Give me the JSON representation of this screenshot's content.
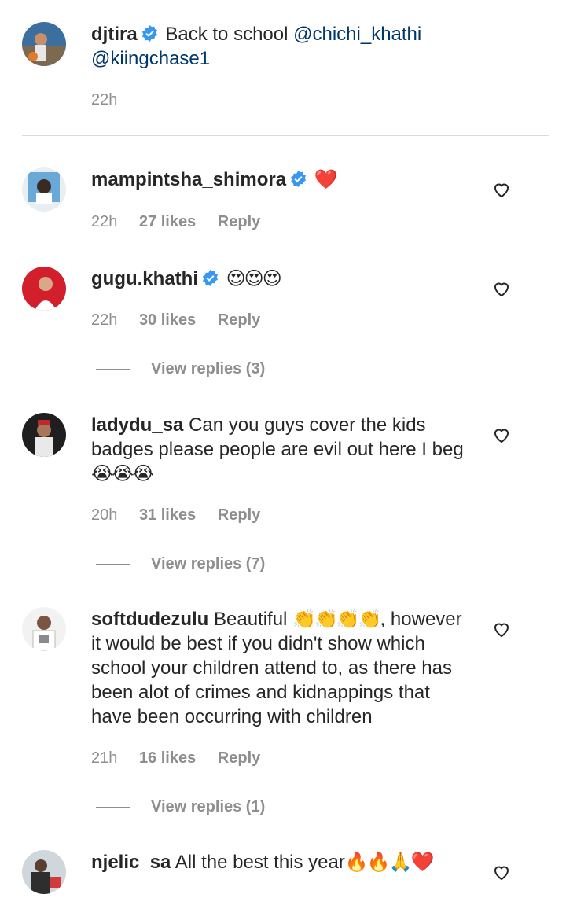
{
  "caption": {
    "username": "djtira",
    "text": "Back to school",
    "mentions": [
      "@chichi_khathi",
      "@kiingchase1"
    ],
    "time": "22h"
  },
  "comments": [
    {
      "username": "mampintsha_shimora",
      "verified": true,
      "text": "",
      "emoji": "❤️",
      "time": "22h",
      "likes": "27 likes",
      "reply": "Reply",
      "avatar_color": "#6aa8d8"
    },
    {
      "username": "gugu.khathi",
      "verified": true,
      "text": "",
      "emoji": "😍😍😍",
      "time": "22h",
      "likes": "30 likes",
      "reply": "Reply",
      "view_replies": "View replies (3)",
      "avatar_color": "#d21f2b"
    },
    {
      "username": "ladydu_sa",
      "verified": false,
      "text": "Can you guys cover the kids badges please people are evil out here I beg",
      "emoji": "😭😭😭",
      "time": "20h",
      "likes": "31 likes",
      "reply": "Reply",
      "view_replies": "View replies (7)",
      "avatar_color": "#2b2b2b"
    },
    {
      "username": "softdudezulu",
      "verified": false,
      "text_a": "Beautiful",
      "emoji": "👏👏👏👏",
      "text_b": ", however it would be best if you didn't show which school your children attend to, as there has been alot of crimes and kidnappings that have been occurring with children",
      "time": "21h",
      "likes": "16 likes",
      "reply": "Reply",
      "view_replies": "View replies (1)",
      "avatar_color": "#8a8a8a"
    },
    {
      "username": "njelic_sa",
      "verified": false,
      "text": "All the best this year",
      "emoji": "🔥🔥🙏❤️",
      "avatar_color": "#5b6b7a"
    }
  ],
  "icons": {
    "verified": "verified-badge-icon",
    "heart": "heart-outline-icon"
  },
  "colors": {
    "verified_blue": "#3897f0",
    "mention_blue": "#00376b",
    "meta_gray": "#8e8e8e"
  }
}
